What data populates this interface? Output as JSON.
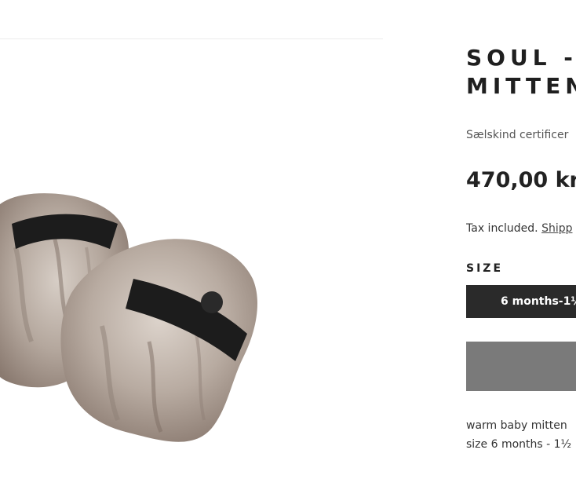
{
  "product": {
    "title_line1": "SOUL -",
    "title_line2": "MITTEN",
    "subtitle": "Sælskind certificer",
    "price": "470,00 kr",
    "tax_text": "Tax included.",
    "shipping_link": "Shipp",
    "size_label": "SIZE",
    "size_selected": "6 months-1½",
    "add_to_cart_label": "",
    "description_line1": "warm baby mitten",
    "description_line2": "size 6 months - 1½"
  },
  "image": {
    "icon": "product-photo-sealskin-mittens",
    "fur_color": "#b7aba3",
    "strap_color": "#1c1c1c"
  },
  "colors": {
    "selected_size_bg": "#2a2a2a",
    "button_bg": "#7a7a7a"
  }
}
